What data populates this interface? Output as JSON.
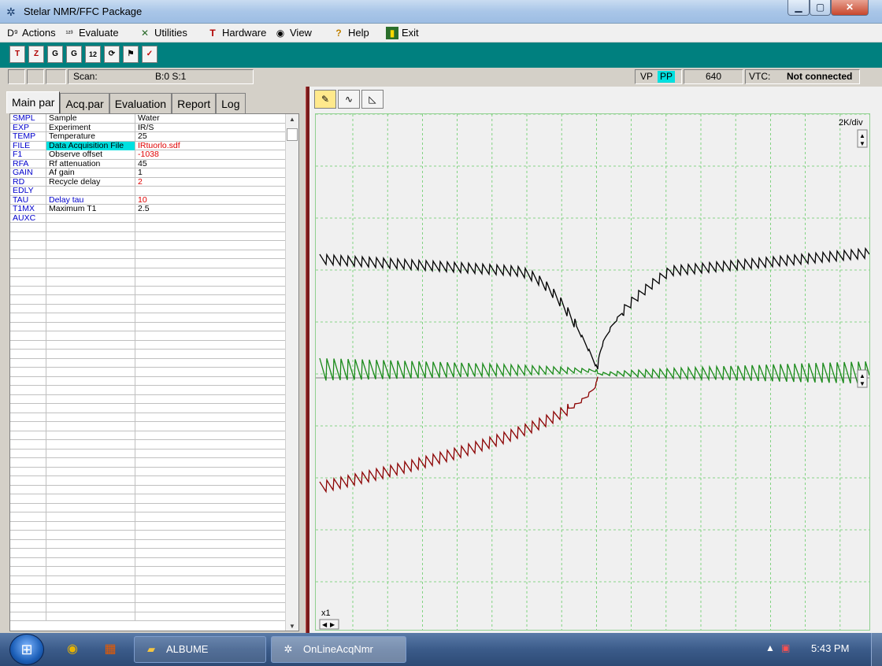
{
  "window": {
    "title": "Stelar NMR/FFC Package"
  },
  "menu": [
    {
      "label": "Actions",
      "icon": "actions-icon",
      "glyph": "D⁹"
    },
    {
      "label": "Evaluate",
      "icon": "evaluate-icon",
      "glyph": "¹²³"
    },
    {
      "label": "Utilities",
      "icon": "utilities-icon",
      "glyph": "✕"
    },
    {
      "label": "Hardware",
      "icon": "hardware-icon",
      "glyph": "T"
    },
    {
      "label": "View",
      "icon": "eye-icon",
      "glyph": "◉"
    },
    {
      "label": "Help",
      "icon": "help-icon",
      "glyph": "?"
    },
    {
      "label": "Exit",
      "icon": "exit-icon",
      "glyph": "▮"
    }
  ],
  "toolbar": [
    {
      "name": "settings-tool-button",
      "glyph": "T"
    },
    {
      "name": "zap-button",
      "glyph": "Z"
    },
    {
      "name": "fi-button",
      "glyph": "G"
    },
    {
      "name": "ti-button",
      "glyph": "G"
    },
    {
      "name": "one-two-button",
      "glyph": "12"
    },
    {
      "name": "cycle-button",
      "glyph": "⟳"
    },
    {
      "name": "flag-button",
      "glyph": "⚑"
    },
    {
      "name": "check-button",
      "glyph": "✓"
    }
  ],
  "status": {
    "scan_label": "Scan:",
    "scan_value": "B:0 S:1",
    "vp": "VP",
    "pp": "PP",
    "count": "640",
    "vtc_label": "VTC:",
    "vtc_value": "Not connected"
  },
  "tabs": [
    "Main par",
    "Acq.par",
    "Evaluation",
    "Report",
    "Log"
  ],
  "params": [
    {
      "code": "SMPL",
      "name": "Sample",
      "value": "Water",
      "red": false,
      "hl": false
    },
    {
      "code": "EXP",
      "name": "Experiment",
      "value": "IR/S",
      "red": false,
      "hl": false
    },
    {
      "code": "TEMP",
      "name": "Temperature",
      "value": "25",
      "red": false,
      "hl": false
    },
    {
      "code": "FILE",
      "name": "Data Acquisition File",
      "value": "IRtuorlo.sdf",
      "red": true,
      "hl": true
    },
    {
      "code": "F1",
      "name": "Observe offset",
      "value": "-1038",
      "red": true,
      "hl": false
    },
    {
      "code": "RFA",
      "name": "Rf attenuation",
      "value": "45",
      "red": false,
      "hl": false
    },
    {
      "code": "GAIN",
      "name": "Af gain",
      "value": "1",
      "red": false,
      "hl": false
    },
    {
      "code": "RD",
      "name": "Recycle delay",
      "value": "2",
      "red": true,
      "hl": false
    },
    {
      "code": "EDLY",
      "name": "",
      "value": "",
      "red": false,
      "hl": false
    },
    {
      "code": "TAU",
      "name": "Delay tau",
      "value": "10",
      "red": true,
      "hl": false,
      "blue_name": true
    },
    {
      "code": "T1MX",
      "name": "Maximum T1",
      "value": "2.5",
      "red": false,
      "hl": false
    },
    {
      "code": "AUXC",
      "name": "",
      "value": "",
      "red": false,
      "hl": false
    }
  ],
  "plot": {
    "scale_label": "2K/div",
    "x_scale_label": "x1",
    "colors": {
      "black": "#000000",
      "green": "#1a8a1a",
      "red": "#8b0000",
      "grid": "#66cc66"
    }
  },
  "taskbar": {
    "pins": [
      {
        "name": "chrome-icon",
        "glyph": "◉",
        "color": "#e8b400"
      },
      {
        "name": "app-pin-icon",
        "glyph": "▦",
        "color": "#e85a00"
      }
    ],
    "tasks": [
      {
        "label": "ALBUME",
        "icon": "folder-icon",
        "glyph": "▰",
        "active": false
      },
      {
        "label": "OnLineAcqNmr",
        "icon": "nmr-app-icon",
        "glyph": "✲",
        "active": true
      }
    ],
    "time": "5:43 PM"
  }
}
